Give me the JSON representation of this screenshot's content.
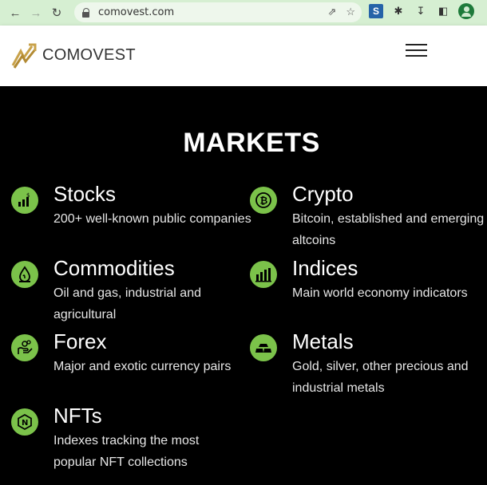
{
  "browser": {
    "url": "comovest.com"
  },
  "site": {
    "logo_text": "COMOVEST"
  },
  "markets": {
    "title": "MARKETS",
    "items": [
      {
        "title": "Stocks",
        "description": "200+ well-known public companies",
        "icon": "stocks-chart-icon"
      },
      {
        "title": "Crypto",
        "description": "Bitcoin, established and emerging altcoins",
        "icon": "bitcoin-icon"
      },
      {
        "title": "Commodities",
        "description": "Oil and gas, industrial and agricultural",
        "icon": "oil-drop-icon"
      },
      {
        "title": "Indices",
        "description": "Main world economy indicators",
        "icon": "bar-chart-icon"
      },
      {
        "title": "Forex",
        "description": "Major and exotic currency pairs",
        "icon": "hand-coins-icon"
      },
      {
        "title": "Metals",
        "description": "Gold, silver, other precious and industrial metals",
        "icon": "gold-bars-icon"
      },
      {
        "title": "NFTs",
        "description": "Indexes tracking the most popular NFT collections",
        "icon": "nft-icon"
      }
    ]
  },
  "colors": {
    "accent": "#7bc24a",
    "chrome": "#d6efd2",
    "background": "#000000"
  }
}
